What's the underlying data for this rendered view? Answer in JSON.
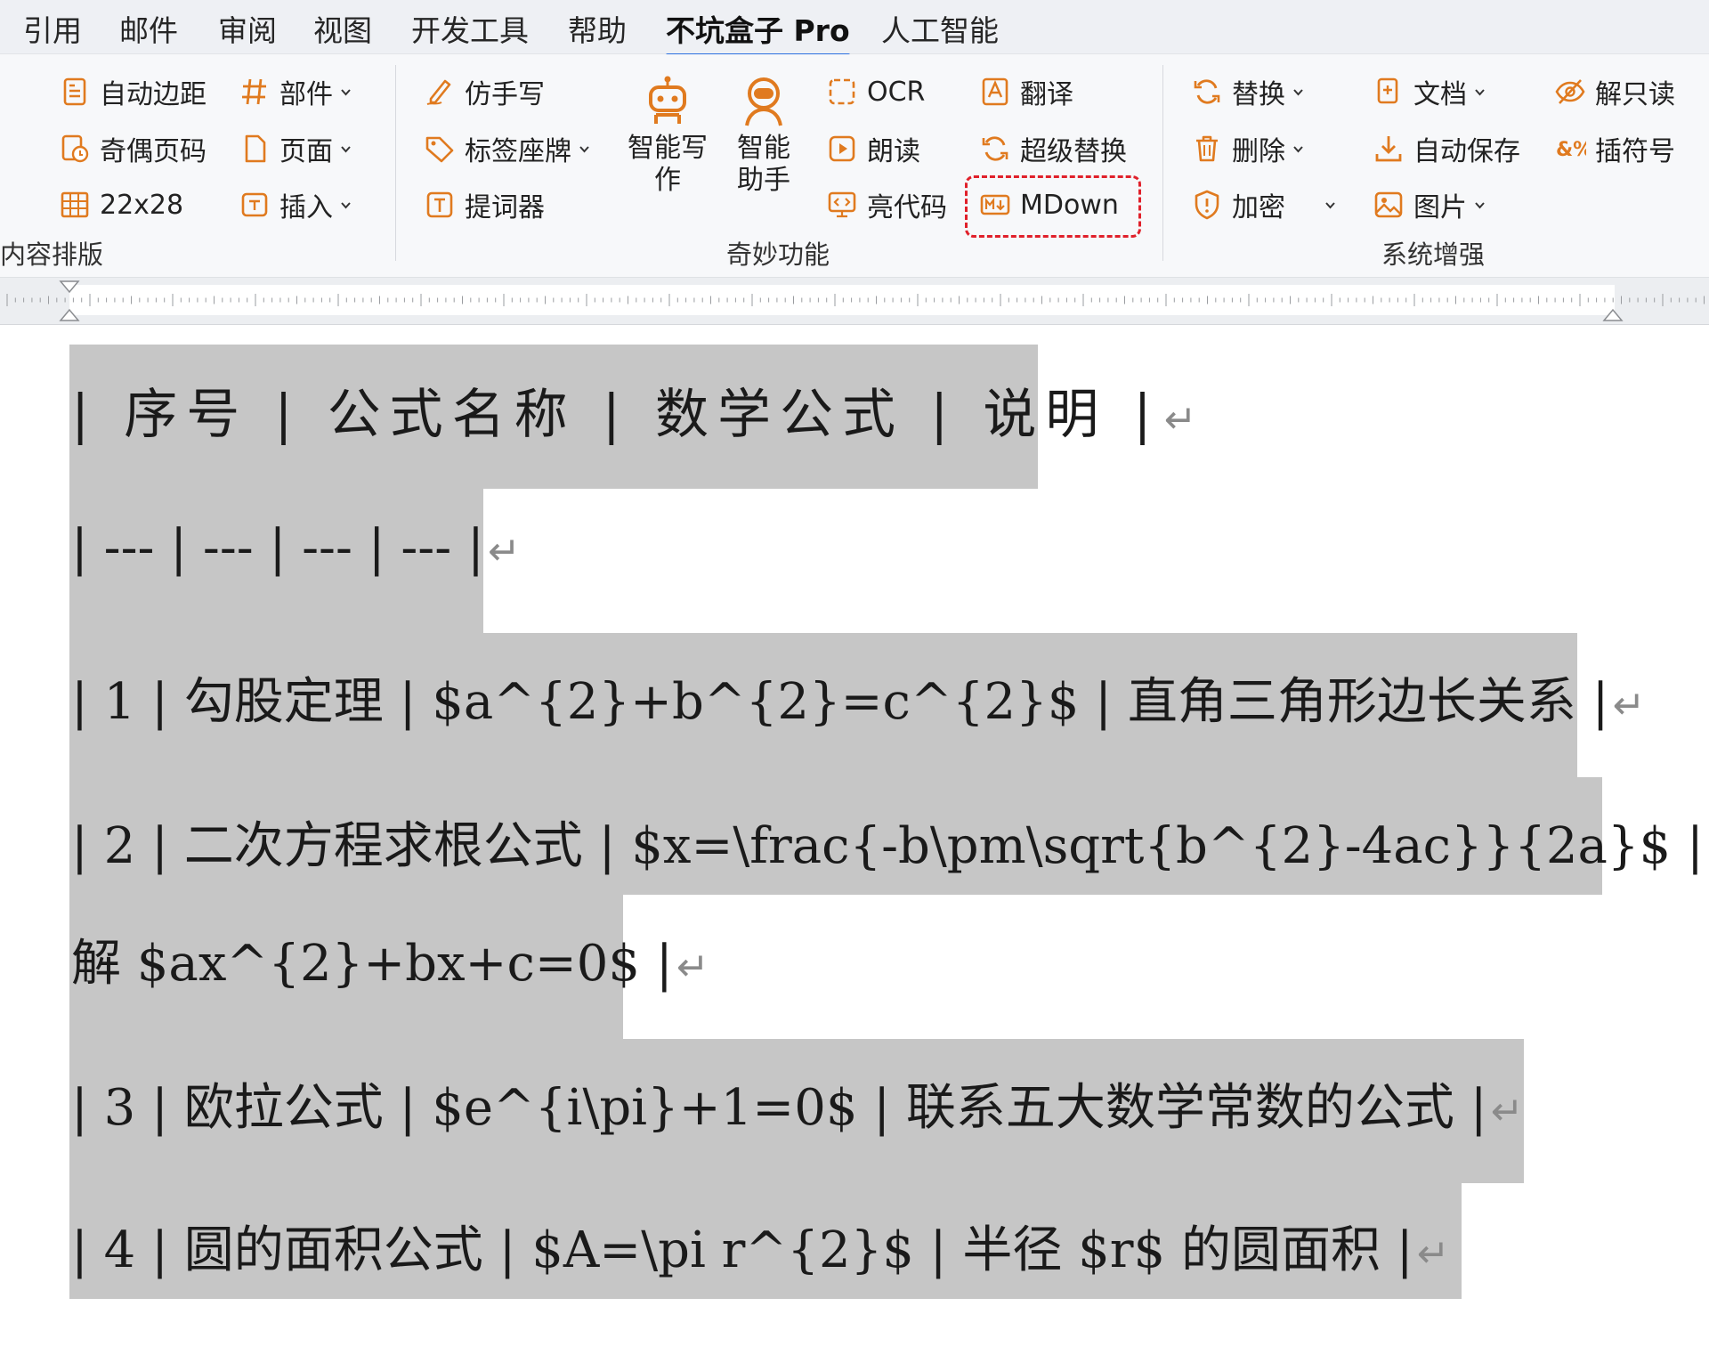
{
  "tabs": [
    "引用",
    "邮件",
    "审阅",
    "视图",
    "开发工具",
    "帮助",
    "不坑盒子 Pro",
    "人工智能"
  ],
  "active_tab": "不坑盒子 Pro",
  "ribbon": {
    "group1": {
      "label": "内容排版",
      "items": [
        "自动边距",
        "部件",
        "奇偶页码",
        "页面",
        "22x28",
        "插入"
      ]
    },
    "group2": {
      "label": "奇妙功能",
      "items": [
        "仿手写",
        "标签座牌",
        "提词器",
        "智能写作",
        "智能助手",
        "OCR",
        "朗读",
        "亮代码",
        "翻译",
        "超级替换",
        "MDown"
      ]
    },
    "group3": {
      "label": "系统增强",
      "items": [
        "替换",
        "文档",
        "解只读",
        "删除",
        "自动保存",
        "插符号",
        "加密",
        "图片"
      ]
    }
  },
  "document": {
    "lines": [
      "| 序号 | 公式名称 | 数学公式 | 说明 |",
      "| --- | --- | --- | --- |",
      "| 1 | 勾股定理 | $a^{2}+b^{2}=c^{2}$ | 直角三角形边长关系 |",
      "| 2 | 二次方程求根公式 | $x=\\frac{-b\\pm\\sqrt{b^{2}-4ac}}{2a}$ |",
      "解 $ax^{2}+bx+c=0$ |",
      "| 3 | 欧拉公式 | $e^{i\\pi}+1=0$ | 联系五大数学常数的公式 |",
      "| 4 | 圆的面积公式 | $A=\\pi r^{2}$ | 半径 $r$ 的圆面积 |"
    ],
    "return_mark": "↵"
  },
  "colors": {
    "accent": "#2b6fe0",
    "icon": "#e07a1f",
    "highlight": "#e0202a",
    "selection": "#c6c6c6"
  }
}
